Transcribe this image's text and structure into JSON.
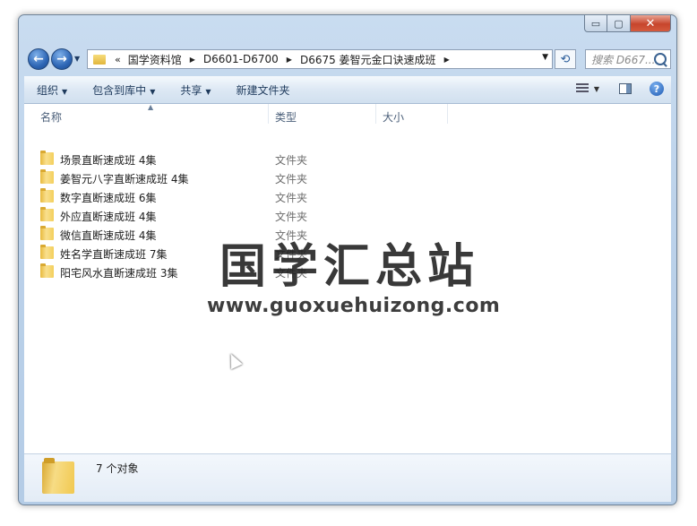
{
  "window": {
    "caption": {
      "minimize": "▭",
      "maximize": "▢",
      "close": "✕"
    }
  },
  "address": {
    "overflow": "«",
    "crumbs": [
      "国学资料馆",
      "D6601-D6700",
      "D6675 姜智元金口诀速成班"
    ],
    "search_placeholder": "搜索 D667..."
  },
  "toolbar": {
    "organize": "组织",
    "include_library": "包含到库中",
    "share": "共享",
    "new_folder": "新建文件夹"
  },
  "columns": {
    "name": "名称",
    "type": "类型",
    "size": "大小"
  },
  "rows": [
    {
      "name": "场景直断速成班 4集",
      "type": "文件夹"
    },
    {
      "name": "姜智元八字直断速成班 4集",
      "type": "文件夹"
    },
    {
      "name": "数字直断速成班 6集",
      "type": "文件夹"
    },
    {
      "name": "外应直断速成班 4集",
      "type": "文件夹"
    },
    {
      "name": "微信直断速成班 4集",
      "type": "文件夹"
    },
    {
      "name": "姓名学直断速成班 7集",
      "type": "文件夹"
    },
    {
      "name": "阳宅风水直断速成班 3集",
      "type": "文件夹"
    }
  ],
  "watermark": {
    "title": "国学汇总站",
    "url": "www.guoxuehuizong.com"
  },
  "status": {
    "count": "7 个对象"
  },
  "icons": [
    "back-arrow-icon",
    "forward-arrow-icon",
    "folder-icon",
    "refresh-icon",
    "search-icon",
    "view-options-icon",
    "preview-pane-icon",
    "help-icon"
  ]
}
